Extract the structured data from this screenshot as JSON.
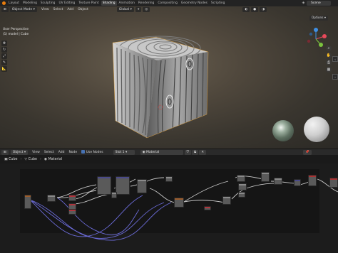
{
  "workspace_tabs": [
    "Layout",
    "Modeling",
    "Sculpting",
    "UV Editing",
    "Texture Paint",
    "Shading",
    "Animation",
    "Rendering",
    "Compositing",
    "Geometry Nodes",
    "Scripting"
  ],
  "active_tab": "Shading",
  "scene": {
    "label": "Scene"
  },
  "viewport": {
    "mode": "Object Mode",
    "menus": [
      "View",
      "Select",
      "Add",
      "Object"
    ],
    "transform_orientation": "Global",
    "perspective_label": "User Perspective",
    "object_label": "(1) model | Cube",
    "options_label": "Options",
    "icons": [
      "move-icon",
      "rotate-icon",
      "scale-icon",
      "measure-icon",
      "annotate-icon"
    ],
    "gizmo_axes": {
      "x_color": "#e8495a",
      "y_color": "#7bc33e",
      "z_color": "#3f8fe3"
    }
  },
  "node_editor": {
    "object_type": "Object",
    "menus": [
      "View",
      "Select",
      "Add",
      "Node"
    ],
    "use_nodes_label": "Use Nodes",
    "slot": "Slot 1",
    "material": "Material",
    "breadcrumb": [
      "Cube",
      "Cube",
      "Material"
    ]
  },
  "colors": {
    "accent": "#4772b3",
    "blender_orange": "#e87d0d"
  }
}
